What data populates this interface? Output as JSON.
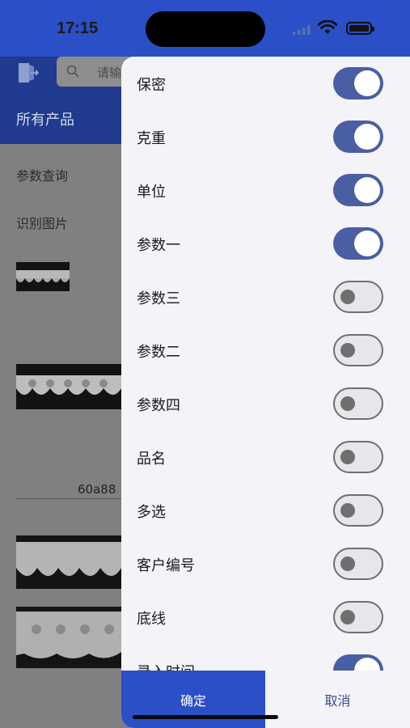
{
  "status_bar": {
    "time": "17:15"
  },
  "background": {
    "search_placeholder": "请输",
    "title": "所有产品",
    "menu": [
      "参数查询",
      "识别图片"
    ],
    "product_code": "60a88"
  },
  "drawer": {
    "options": [
      {
        "label": "保密",
        "on": true
      },
      {
        "label": "克重",
        "on": true
      },
      {
        "label": "单位",
        "on": true
      },
      {
        "label": "参数一",
        "on": true
      },
      {
        "label": "参数三",
        "on": false
      },
      {
        "label": "参数二",
        "on": false
      },
      {
        "label": "参数四",
        "on": false
      },
      {
        "label": "品名",
        "on": false
      },
      {
        "label": "多选",
        "on": false
      },
      {
        "label": "客户编号",
        "on": false
      },
      {
        "label": "底线",
        "on": false
      },
      {
        "label": "录入时间",
        "on": true
      }
    ],
    "confirm_label": "确定",
    "cancel_label": "取消"
  },
  "colors": {
    "accent": "#2a4fc6",
    "switch_on": "#4a5ea3",
    "drawer_bg": "#f3f3f8"
  }
}
